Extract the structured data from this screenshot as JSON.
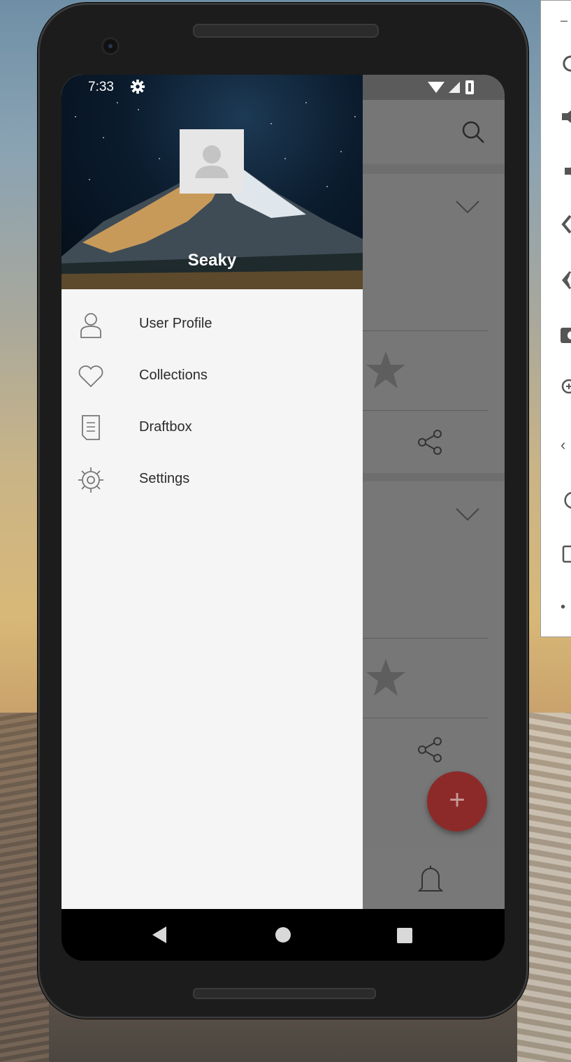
{
  "status_bar": {
    "time": "7:33"
  },
  "drawer": {
    "user_name": "Seaky",
    "items": [
      {
        "label": "User Profile",
        "icon": "user-icon"
      },
      {
        "label": "Collections",
        "icon": "heart-icon"
      },
      {
        "label": "Draftbox",
        "icon": "document-icon"
      },
      {
        "label": "Settings",
        "icon": "gear-icon"
      }
    ]
  },
  "fab": {
    "label": "+",
    "color": "#c53a3a"
  },
  "colors": {
    "drawer_bg": "#f5f5f5",
    "scrim": "#757575",
    "accent": "#c53a3a"
  }
}
